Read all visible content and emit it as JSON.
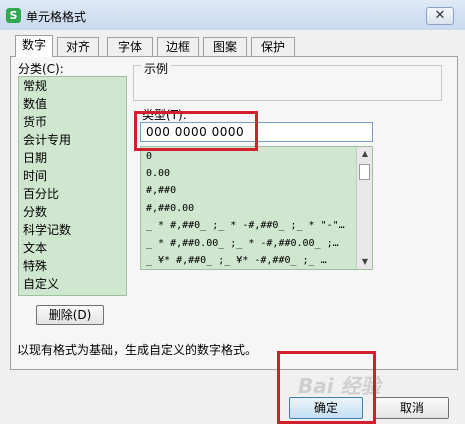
{
  "window": {
    "title": "单元格格式",
    "app_icon_letter": "S",
    "close_symbol": "✕"
  },
  "tabs": [
    {
      "label": "数字",
      "active": true
    },
    {
      "label": "对齐"
    },
    {
      "label": "字体"
    },
    {
      "label": "边框"
    },
    {
      "label": "图案"
    },
    {
      "label": "保护"
    }
  ],
  "category": {
    "label": "分类(C):",
    "items": [
      "常规",
      "数值",
      "货币",
      "会计专用",
      "日期",
      "时间",
      "百分比",
      "分数",
      "科学记数",
      "文本",
      "特殊",
      "自定义"
    ],
    "selected": "自定义"
  },
  "sample": {
    "label": "示例"
  },
  "type_field": {
    "label": "类型(T):",
    "value": "000  0000  0000"
  },
  "format_list": {
    "items": [
      "0",
      "0.00",
      "#,##0",
      "#,##0.00",
      "_ * #,##0_ ;_ * -#,##0_ ;_ * \"-\"…",
      "_ * #,##0.00_ ;_ * -#,##0.00_ ;…",
      "_ ¥* #,##0_ ;_ ¥* -#,##0_ ;_ …"
    ],
    "scroll_up_icon": "▲",
    "scroll_down_icon": "▼"
  },
  "delete_button": {
    "label": "删除(D)"
  },
  "description": "以现有格式为基础，生成自定义的数字格式。",
  "buttons": {
    "ok": "确定",
    "cancel": "取消"
  },
  "watermark": "Bai 经验",
  "colors": {
    "list_bg": "#cfe6cf",
    "highlight_box": "#d21f2e",
    "title_bar": "#d3e1f3"
  }
}
